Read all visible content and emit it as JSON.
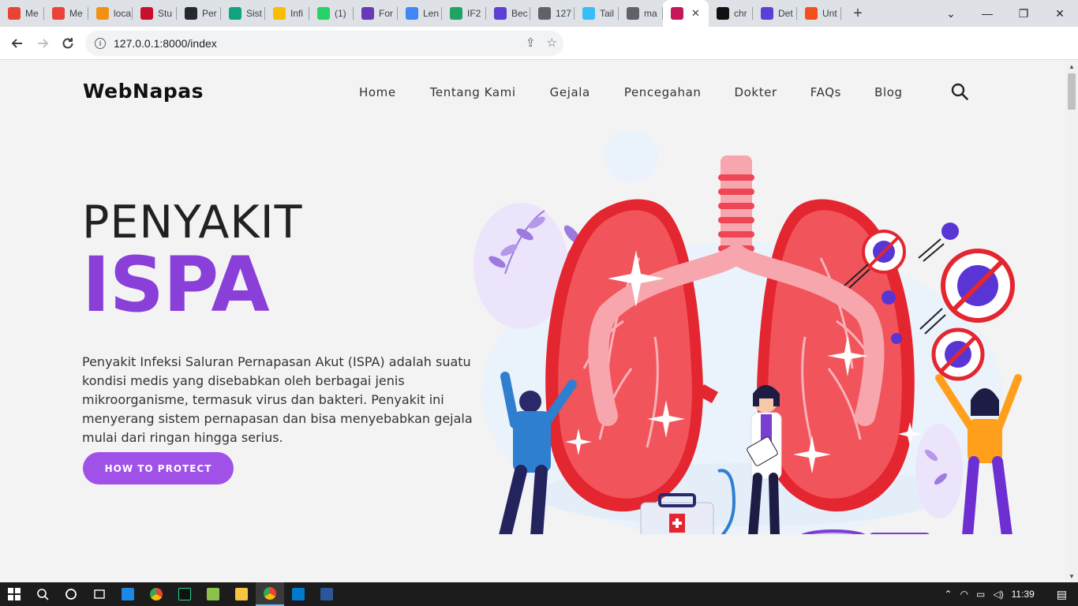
{
  "browser": {
    "tabs": [
      {
        "label": "Me",
        "icon": "gmail-icon",
        "color": "#ea4335"
      },
      {
        "label": "Me",
        "icon": "gmail-icon",
        "color": "#ea4335"
      },
      {
        "label": "loca",
        "icon": "phpmyadmin-icon",
        "color": "#f29111"
      },
      {
        "label": "Stu",
        "icon": "studio-icon",
        "color": "#c8102e"
      },
      {
        "label": "Per",
        "icon": "github-icon",
        "color": "#24292e"
      },
      {
        "label": "Sist",
        "icon": "chatgpt-icon",
        "color": "#10a37f"
      },
      {
        "label": "Infi",
        "icon": "chrome-icon",
        "color": "#fbbc05"
      },
      {
        "label": "(1)",
        "icon": "whatsapp-icon",
        "color": "#25d366"
      },
      {
        "label": "For",
        "icon": "forms-icon",
        "color": "#673ab7"
      },
      {
        "label": "Len",
        "icon": "lens-icon",
        "color": "#4285f4"
      },
      {
        "label": "IF2",
        "icon": "drive-icon",
        "color": "#1fa463"
      },
      {
        "label": "Bec",
        "icon": "app-icon",
        "color": "#5b3fd6"
      },
      {
        "label": "127",
        "icon": "globe-icon",
        "color": "#5f6368"
      },
      {
        "label": "Tail",
        "icon": "tailwind-icon",
        "color": "#38bdf8"
      },
      {
        "label": "ma",
        "icon": "globe-icon",
        "color": "#5f6368"
      },
      {
        "label": "",
        "icon": "webnapas-icon",
        "color": "#c2185b",
        "active": true
      },
      {
        "label": "chr",
        "icon": "s-icon",
        "color": "#111111"
      },
      {
        "label": "Det",
        "icon": "app-icon",
        "color": "#5b3fd6"
      },
      {
        "label": "Unt",
        "icon": "figma-icon",
        "color": "#f24e1e"
      }
    ],
    "close_glyph": "✕",
    "newtab_glyph": "+",
    "url": "127.0.0.1:8000/index",
    "time": "11:39"
  },
  "site": {
    "logo": "WebNapas",
    "nav": [
      "Home",
      "Tentang Kami",
      "Gejala",
      "Pencegahan",
      "Dokter",
      "FAQs",
      "Blog"
    ],
    "hero_kicker": "PENYAKIT",
    "hero_title": "ISPA",
    "hero_desc": "Penyakit Infeksi Saluran Pernapasan Akut (ISPA) adalah suatu kondisi medis yang disebabkan oleh berbagai jenis mikroorganisme, termasuk virus dan bakteri. Penyakit ini menyerang sistem pernapasan dan bisa menyebabkan gejala mulai dari ringan hingga serius.",
    "cta": "HOW TO PROTECT"
  },
  "colors": {
    "accent": "#8b3fd9",
    "button": "#a052e8",
    "lung": "#f2545b",
    "lung_dark": "#e3262f"
  }
}
